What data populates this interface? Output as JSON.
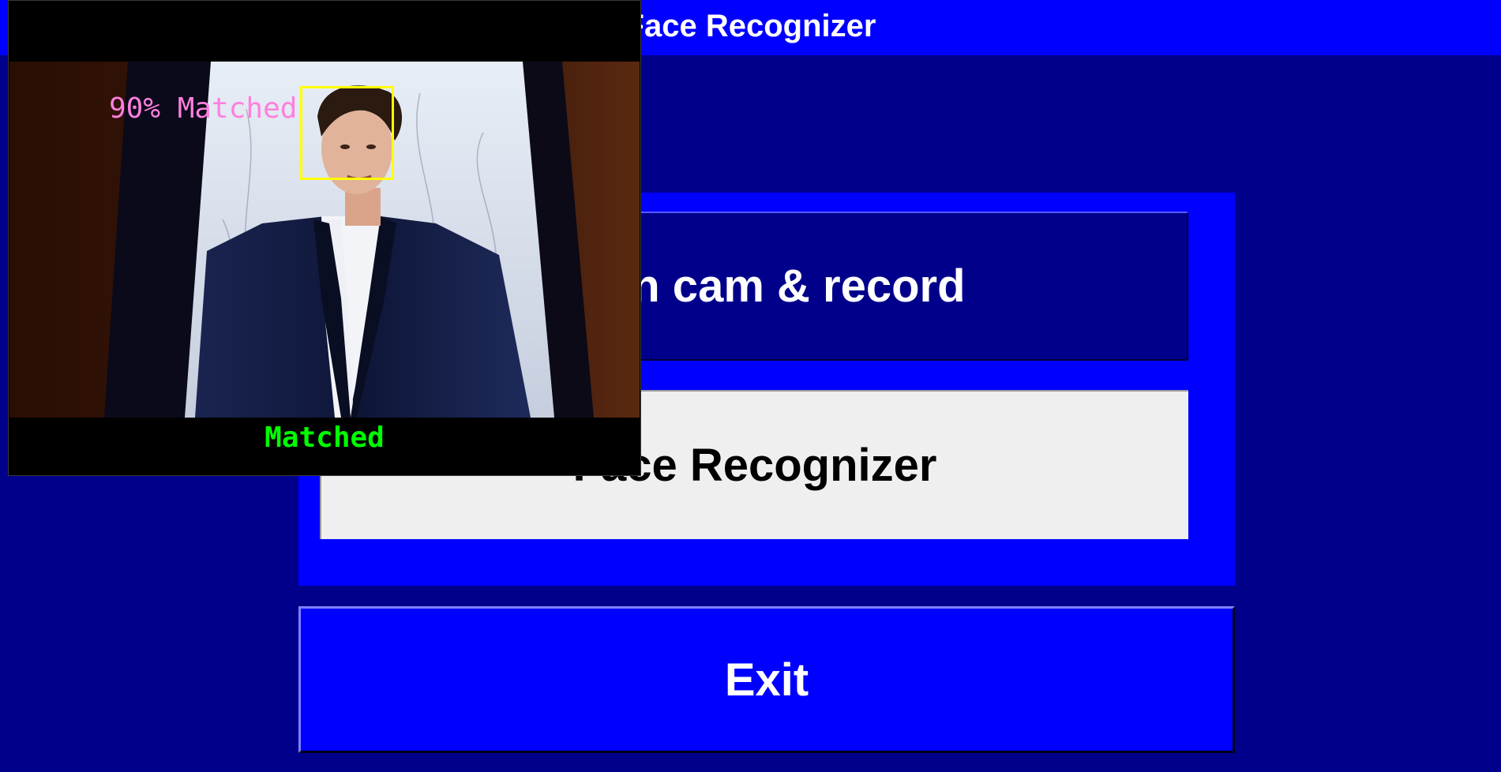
{
  "window": {
    "title": "Face Recognizer",
    "background_color": "#00008b",
    "title_bar_color": "#0000ff"
  },
  "buttons": {
    "open_cam_label": "Open cam & record",
    "face_recognizer_label": "Face Recognizer",
    "exit_label": "Exit"
  },
  "camera_window": {
    "match_confidence_label": "90% Matched",
    "match_status_label": "Matched",
    "confidence_color": "#ff7fdf",
    "status_color": "#00ff00",
    "face_box_color": "#ffff00"
  }
}
